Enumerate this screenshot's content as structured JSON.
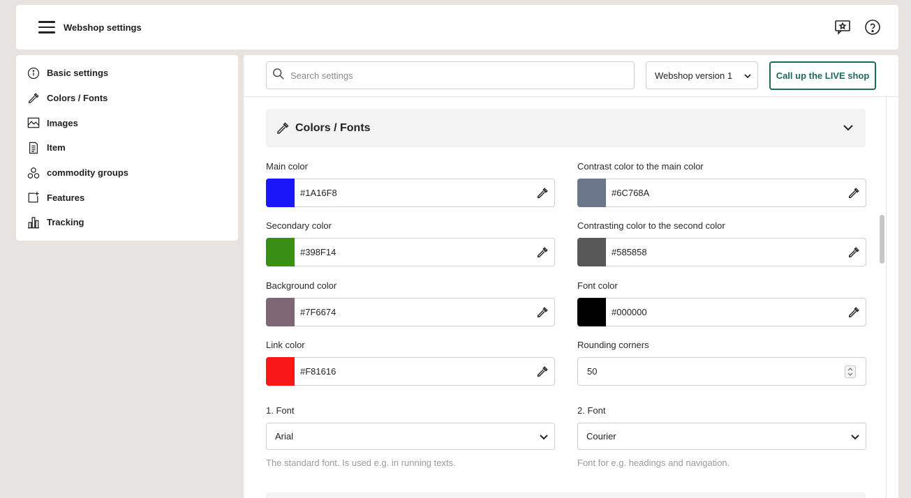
{
  "header": {
    "title": "Webshop settings"
  },
  "sidebar": {
    "items": [
      {
        "label": "Basic settings",
        "icon": "info-icon"
      },
      {
        "label": "Colors / Fonts",
        "icon": "eyedropper-icon"
      },
      {
        "label": "Images",
        "icon": "image-icon"
      },
      {
        "label": "Item",
        "icon": "document-icon"
      },
      {
        "label": "commodity groups",
        "icon": "groups-icon"
      },
      {
        "label": "Features",
        "icon": "add-feature-icon"
      },
      {
        "label": "Tracking",
        "icon": "bar-chart-icon"
      }
    ]
  },
  "toolbar": {
    "search_placeholder": "Search settings",
    "version_selected": "Webshop version 1",
    "live_button": "Call up the LIVE shop"
  },
  "section": {
    "title": "Colors / Fonts",
    "fields": {
      "main_color": {
        "label": "Main color",
        "value": "#1A16F8",
        "swatch": "#1a16f8"
      },
      "contrast_main": {
        "label": "Contrast color to the main color",
        "value": "#6C768A",
        "swatch": "#6c768a"
      },
      "secondary_color": {
        "label": "Secondary color",
        "value": "#398F14",
        "swatch": "#398f14"
      },
      "contrast_second": {
        "label": "Contrasting color to the second color",
        "value": "#585858",
        "swatch": "#585858"
      },
      "background_color": {
        "label": "Background color",
        "value": "#7F6674",
        "swatch": "#7f6674"
      },
      "font_color": {
        "label": "Font color",
        "value": "#000000",
        "swatch": "#000000"
      },
      "link_color": {
        "label": "Link color",
        "value": "#F81616",
        "swatch": "#f81616"
      },
      "rounding_corners": {
        "label": "Rounding corners",
        "value": "50"
      },
      "font1": {
        "label": "1. Font",
        "value": "Arial",
        "hint": "The standard font. Is used e.g. in running texts."
      },
      "font2": {
        "label": "2. Font",
        "value": "Courier",
        "hint": "Font for e.g. headings and navigation."
      }
    }
  },
  "colors": {
    "accent": "#1a6b5a"
  }
}
